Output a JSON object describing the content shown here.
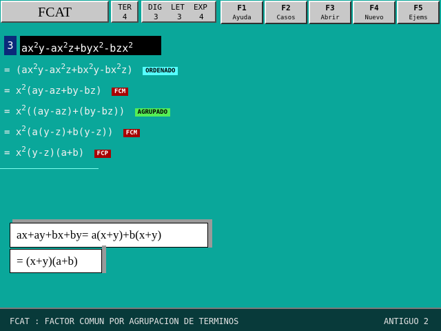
{
  "app": {
    "title": "FCAT"
  },
  "stats": {
    "ter_label": "TER",
    "ter_value": "4",
    "dig_label": "DIG",
    "dig_value": "3",
    "let_label": "LET",
    "let_value": "3",
    "exp_label": "EXP",
    "exp_value": "4"
  },
  "fkeys": [
    {
      "key": "F1",
      "label": "Ayuda"
    },
    {
      "key": "F2",
      "label": "Casos"
    },
    {
      "key": "F3",
      "label": "Abrir"
    },
    {
      "key": "F4",
      "label": "Nuevo"
    },
    {
      "key": "F5",
      "label": "Ejems"
    }
  ],
  "problem": {
    "number": "3"
  },
  "steps": [
    {
      "tag": "ORDENADO"
    },
    {
      "tag": "FCM"
    },
    {
      "tag": "AGRUPADO"
    },
    {
      "tag": "FCM"
    },
    {
      "tag": "FCP"
    }
  ],
  "examples": {
    "line1": "ax+ay+bx+by=  a(x+y)+b(x+y)",
    "line2": "=  (x+y)(a+b)"
  },
  "status": {
    "left": "FCAT : FACTOR COMUN POR AGRUPACION DE TERMINOS",
    "right": "ANTIGUO  2"
  },
  "colors": {
    "background": "#0aa79a",
    "status_bar": "#083a3a"
  }
}
